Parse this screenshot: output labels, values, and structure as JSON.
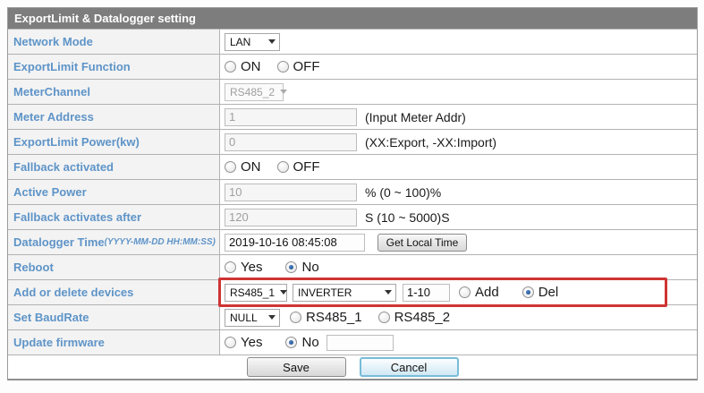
{
  "header": {
    "title": "ExportLimit & Datalogger setting"
  },
  "colors": {
    "header_bg": "#7d7d7d",
    "label_text": "#5e94c8",
    "highlight_red": "#cf3434",
    "cancel_border": "#78bcd9"
  },
  "rows": {
    "network_mode": {
      "label": "Network Mode",
      "select_value": "LAN"
    },
    "exportlimit_function": {
      "label": "ExportLimit Function",
      "on": "ON",
      "off": "OFF",
      "selected": "OFF"
    },
    "meter_channel": {
      "label": "MeterChannel",
      "select_value": "RS485_2",
      "disabled": true
    },
    "meter_address": {
      "label": "Meter Address",
      "value": "1",
      "note": "(Input Meter Addr)"
    },
    "exportlimit_power": {
      "label": "ExportLimit Power(kw)",
      "value": "0",
      "note": "(XX:Export, -XX:Import)"
    },
    "fallback_activated": {
      "label": "Fallback activated",
      "on": "ON",
      "off": "OFF",
      "selected": "OFF"
    },
    "active_power": {
      "label": "Active Power",
      "value": "10",
      "note": "% (0 ~ 100)%"
    },
    "fallback_after": {
      "label": "Fallback activates after",
      "value": "120",
      "note": "S (10 ~ 5000)S"
    },
    "datalogger_time": {
      "label": "Datalogger Time",
      "label_hint": "(YYYY-MM-DD HH:MM:SS)",
      "value": "2019-10-16 08:45:08",
      "button": "Get Local Time"
    },
    "reboot": {
      "label": "Reboot",
      "yes": "Yes",
      "no": "No",
      "selected": "No"
    },
    "add_delete": {
      "label": "Add or delete devices",
      "channel": "RS485_1",
      "device": "INVERTER",
      "range": "1-10",
      "add": "Add",
      "del": "Del",
      "selected": "Del"
    },
    "baudrate": {
      "label": "Set BaudRate",
      "select_value": "NULL",
      "opt1": "RS485_1",
      "opt2": "RS485_2",
      "selected": ""
    },
    "update_firmware": {
      "label": "Update firmware",
      "yes": "Yes",
      "no": "No",
      "selected": "No",
      "value": ""
    }
  },
  "buttons": {
    "save": "Save",
    "cancel": "Cancel"
  }
}
